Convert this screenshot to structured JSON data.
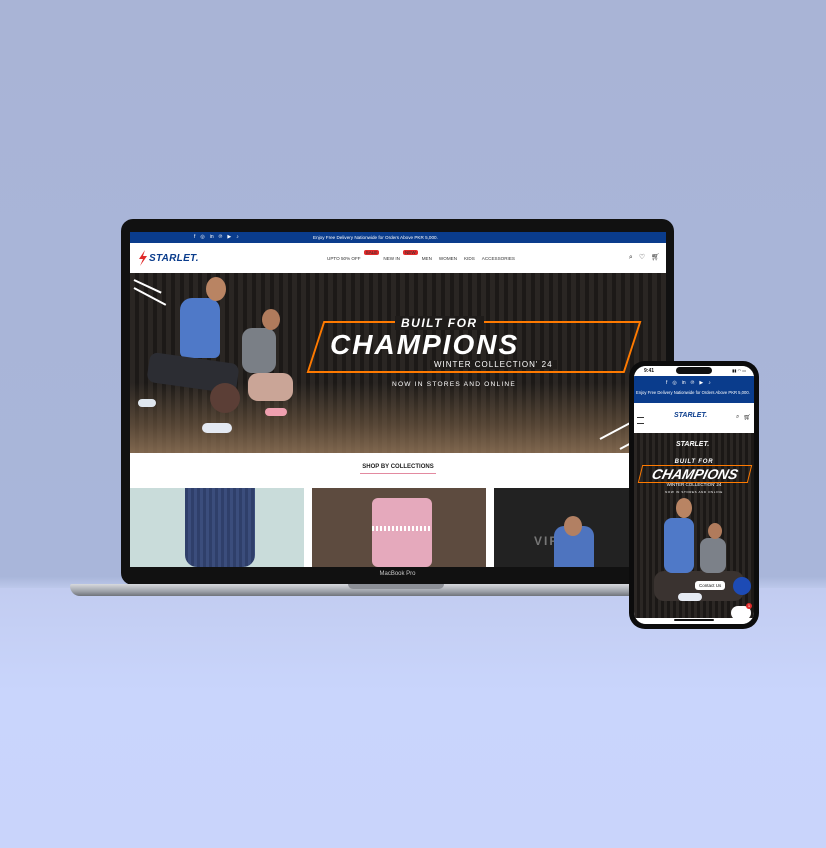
{
  "laptop": {
    "model_label": "MacBook Pro",
    "topbar": {
      "socials": [
        "f",
        "◎",
        "in",
        "℗",
        "▶",
        "♪"
      ],
      "promo": "Enjoy Free Delivery Nationwide for Orders Above PKR 5,000."
    },
    "logo": "STARLET.",
    "menu": [
      {
        "label": "UPTO 50% OFF",
        "badge": "SALE",
        "red": true
      },
      {
        "label": "NEW IN",
        "badge": "NEW",
        "red": false
      },
      {
        "label": "MEN"
      },
      {
        "label": "WOMEN"
      },
      {
        "label": "KIDS"
      },
      {
        "label": "ACCESSORIES"
      }
    ],
    "hero": {
      "built": "BUILT FOR",
      "champions": "CHAMPIONS",
      "collection": "WINTER COLLECTION' 24",
      "stores": "NOW IN STORES AND ONLINE"
    },
    "section_title": "SHOP BY COLLECTIONS",
    "tile3_text": "VIRTUO"
  },
  "phone": {
    "time": "9:41",
    "signal": "▮▮ ◠ ▭",
    "socials": [
      "f",
      "◎",
      "in",
      "℗",
      "▶",
      "♪"
    ],
    "promo": "Enjoy Free Delivery Nationwide for Orders Above PKR 5,000.",
    "logo": "STARLET.",
    "hero_logo": "STARLET.",
    "built": "BUILT FOR",
    "champions": "CHAMPIONS",
    "collection": "WINTER COLLECTION' 24",
    "stores": "NOW IN STORES AND ONLINE",
    "contact": "Contact Us",
    "chat_count": "1"
  }
}
